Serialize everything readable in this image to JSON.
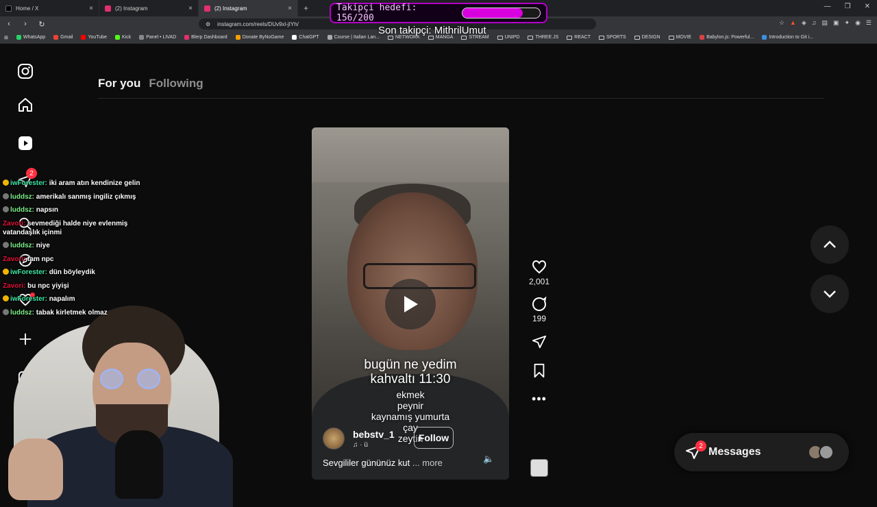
{
  "browser": {
    "tabs": [
      {
        "title": "Home / X",
        "favicon_color": "#000000"
      },
      {
        "title": "(2) Instagram",
        "favicon_color": "#e1306c"
      },
      {
        "title": "(2) Instagram",
        "favicon_color": "#e1306c"
      }
    ],
    "url": "instagram.com/reels/DUv9xl-jIYh/",
    "bookmarks": [
      {
        "label": "WhatsApp",
        "icon": "whatsapp-icon",
        "color": "#25d366"
      },
      {
        "label": "Gmail",
        "icon": "gmail-icon",
        "color": "#ea4335"
      },
      {
        "label": "YouTube",
        "icon": "youtube-icon",
        "color": "#ff0000"
      },
      {
        "label": "Kick",
        "icon": "kick-icon",
        "color": "#53fc18"
      },
      {
        "label": "Panel • LIVAD",
        "icon": "livad-icon",
        "color": "#888888"
      },
      {
        "label": "Blerp Dashboard",
        "icon": "blerp-icon",
        "color": "#e5306c"
      },
      {
        "label": "Donate ByNoGame",
        "icon": "bynogame-icon",
        "color": "#f4a000"
      },
      {
        "label": "ChatGPT",
        "icon": "chatgpt-icon",
        "color": "#ffffff"
      },
      {
        "label": "Course | Italian Lan...",
        "icon": "course-icon",
        "color": "#aaaaaa"
      },
      {
        "label": "NETWORK",
        "icon": "folder-icon",
        "folder": true
      },
      {
        "label": "MANGA",
        "icon": "folder-icon",
        "folder": true
      },
      {
        "label": "STREAM",
        "icon": "folder-icon",
        "folder": true
      },
      {
        "label": "UNIPD",
        "icon": "folder-icon",
        "folder": true
      },
      {
        "label": "THREE.JS",
        "icon": "folder-icon",
        "folder": true
      },
      {
        "label": "REACT",
        "icon": "folder-icon",
        "folder": true
      },
      {
        "label": "SPORTS",
        "icon": "folder-icon",
        "folder": true
      },
      {
        "label": "DESIGN",
        "icon": "folder-icon",
        "folder": true
      },
      {
        "label": "MOVIE",
        "icon": "folder-icon",
        "folder": true
      },
      {
        "label": "Babylon.js: Powerful...",
        "icon": "babylon-icon",
        "color": "#d94141"
      },
      {
        "label": "Introduction to Git i...",
        "icon": "vscode-icon",
        "color": "#3b8fe0"
      }
    ]
  },
  "overlay": {
    "goal_label": "Takipçi hedefi: 156/200",
    "goal_current": 156,
    "goal_target": 200,
    "goal_color": "#d900e0",
    "last_follower": "Son takipçi: MithrilUmut"
  },
  "sidebar": {
    "icons": [
      "instagram-logo-icon",
      "home-icon",
      "reels-icon",
      "messages-icon",
      "search-icon",
      "explore-icon",
      "notifications-icon",
      "create-icon",
      "dashboard-icon",
      "profile-icon"
    ],
    "messages_badge": "2"
  },
  "feed": {
    "tab_active": "For you",
    "tab_inactive": "Following"
  },
  "reel": {
    "caption_title_1": "bugün ne yedim",
    "caption_title_2": "kahvaltı 11:30",
    "caption_items": [
      "ekmek",
      "peynir",
      "kaynamış yumurta",
      "çay",
      "zeytin"
    ],
    "username": "bebstv_1",
    "audio": "ü",
    "follow_label": "Follow",
    "description": "Sevgililer gününüz kut",
    "more_label": "... more",
    "likes": "2,001",
    "comments": "199"
  },
  "messages": {
    "label": "Messages",
    "badge": "2"
  },
  "chat": [
    {
      "user": "iwForester",
      "color": "#3ee8a4",
      "text": "iki aram atın kendinize gelin",
      "badge": "gold"
    },
    {
      "user": "luddsz",
      "color": "#7cf08a",
      "text": "amerikalı sanmış ingiliz çıkmış",
      "badge": "grey"
    },
    {
      "user": "luddsz",
      "color": "#7cf08a",
      "text": "napsın",
      "badge": "grey"
    },
    {
      "user": "Zavori",
      "color": "#e0103a",
      "text": "sevmediği halde niye evlenmiş vatandaşlık içinmi",
      "badge": "none"
    },
    {
      "user": "luddsz",
      "color": "#7cf08a",
      "text": "niye",
      "badge": "grey"
    },
    {
      "user": "Zavori",
      "color": "#e0103a",
      "text": "tam npc",
      "badge": "none"
    },
    {
      "user": "iwForester",
      "color": "#3ee8a4",
      "text": "dün böyleydik",
      "badge": "gold"
    },
    {
      "user": "Zavori",
      "color": "#e0103a",
      "text": "bu npc yiyişi",
      "badge": "none"
    },
    {
      "user": "iwForester",
      "color": "#3ee8a4",
      "text": "napalım",
      "badge": "gold"
    },
    {
      "user": "luddsz",
      "color": "#7cf08a",
      "text": "tabak kirletmek olmaz",
      "badge": "grey"
    }
  ]
}
